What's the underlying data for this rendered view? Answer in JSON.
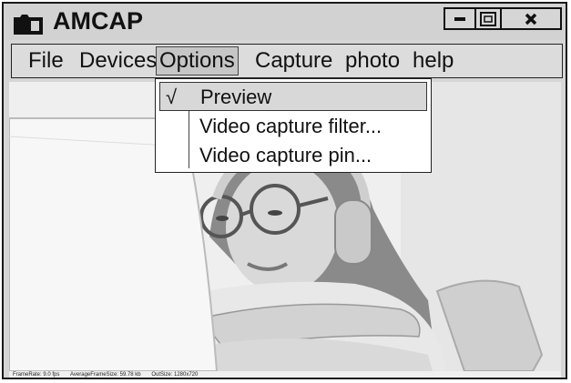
{
  "app": {
    "title": "AMCAP",
    "icon": "folder-camera-icon"
  },
  "window_controls": {
    "minimize_icon": "minimize-icon",
    "maximize_icon": "maximize-icon",
    "close_icon": "close-icon"
  },
  "menu": {
    "file": "File",
    "devices": "Devices",
    "options": "Options",
    "capture": "Capture",
    "photo": "photo",
    "help": "help"
  },
  "options_menu": {
    "items": [
      {
        "label": "Preview",
        "checked": true,
        "check_mark": "√"
      },
      {
        "label": "Video capture filter...",
        "checked": false
      },
      {
        "label": "Video capture pin...",
        "checked": false
      }
    ]
  },
  "status": {
    "frame_rate": "FrameRate: 9.0 fps",
    "avg_frame_size": "AverageFrameSize: 59.78 kb",
    "out_size": "OutSize: 1280x720"
  },
  "colors": {
    "chrome": "#d6d6d6",
    "border": "#1a1a1a",
    "menu_highlight": "#c6c6c6",
    "preview_bg": "#f2f2f2"
  },
  "preview": {
    "content": "video-preview-image"
  }
}
